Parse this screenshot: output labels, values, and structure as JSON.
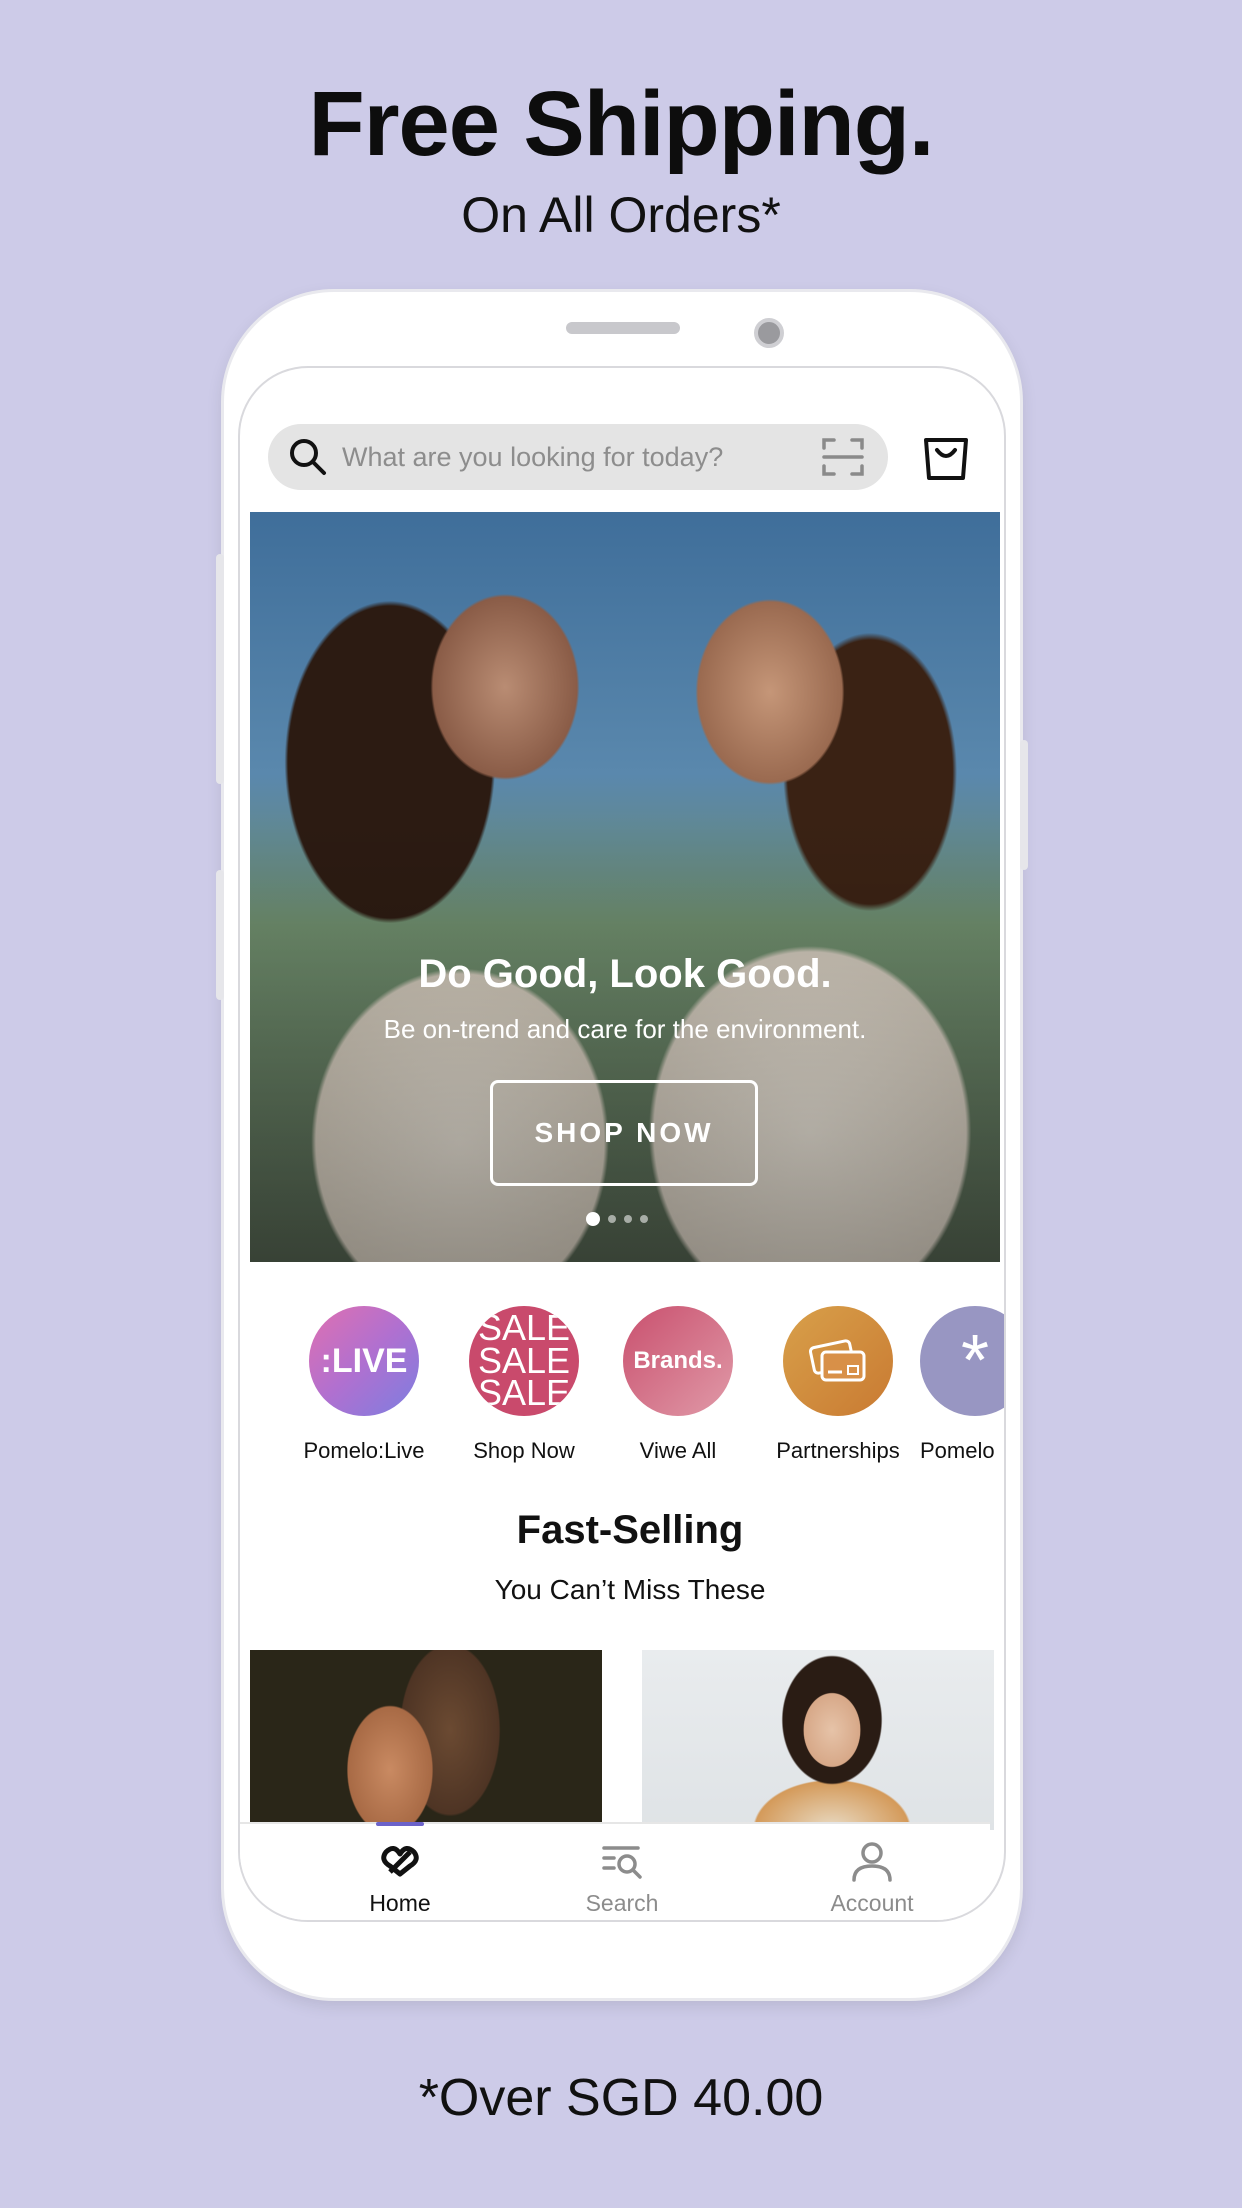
{
  "promo": {
    "headline": "Free Shipping.",
    "subline": "On All Orders*",
    "footnote": "*Over SGD 40.00",
    "background": "#cdcbe8"
  },
  "search": {
    "placeholder": "What are you looking for today?"
  },
  "hero": {
    "title": "Do Good, Look Good.",
    "subtitle": "Be on-trend and care for the environment.",
    "cta_label": "SHOP NOW",
    "slide_count": 4,
    "active_slide": 1
  },
  "categories": [
    {
      "label": "Pomelo:Live",
      "badge": ":LIVE",
      "icon": "live-badge"
    },
    {
      "label": "Shop Now",
      "badge": "SALE",
      "icon": "sale-badge"
    },
    {
      "label": "Viwe All",
      "badge": "Brands.",
      "icon": "brands-badge"
    },
    {
      "label": "Partnerships",
      "badge": "",
      "icon": "card-icon"
    },
    {
      "label": "Pomelo",
      "badge": "*",
      "icon": "asterisk-icon"
    }
  ],
  "section": {
    "title": "Fast-Selling",
    "subtitle": "You Can’t Miss These"
  },
  "bottom_nav": {
    "items": [
      {
        "label": "Home",
        "icon": "pomelo-home-icon",
        "active": true
      },
      {
        "label": "Search",
        "icon": "search-list-icon",
        "active": false
      },
      {
        "label": "Account",
        "icon": "user-icon",
        "active": false
      }
    ],
    "accent": "#6b62c9"
  }
}
